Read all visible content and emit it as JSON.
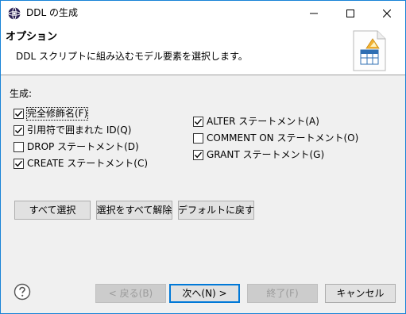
{
  "window": {
    "title": "DDL の生成"
  },
  "banner": {
    "title": "オプション",
    "description": "DDL スクリプトに組み込むモデル要素を選択します。"
  },
  "generate_section": {
    "label": "生成:",
    "options_left": [
      {
        "label": "完全修飾名(F)",
        "checked": true
      },
      {
        "label": "引用符で囲まれた ID(Q)",
        "checked": true
      },
      {
        "label": "DROP ステートメント(D)",
        "checked": false
      },
      {
        "label": "CREATE ステートメント(C)",
        "checked": true
      }
    ],
    "options_right": [
      {
        "label": "ALTER ステートメント(A)",
        "checked": true
      },
      {
        "label": "COMMENT ON ステートメント(O)",
        "checked": false
      },
      {
        "label": "GRANT ステートメント(G)",
        "checked": true
      }
    ]
  },
  "selection_buttons": {
    "select_all": "すべて選択",
    "deselect_all": "選択をすべて解除",
    "restore_defaults": "デフォルトに戻す"
  },
  "footer": {
    "back": "< 戻る(B)",
    "next": "次へ(N) >",
    "finish": "終了(F)",
    "cancel": "キャンセル"
  },
  "icons": {
    "app": "app-icon",
    "banner": "ddl-document-icon",
    "help": "help-icon"
  },
  "colors": {
    "window_border": "#1883d7",
    "default_button_border": "#0078d7",
    "dialog_background": "#f0f0f0"
  }
}
